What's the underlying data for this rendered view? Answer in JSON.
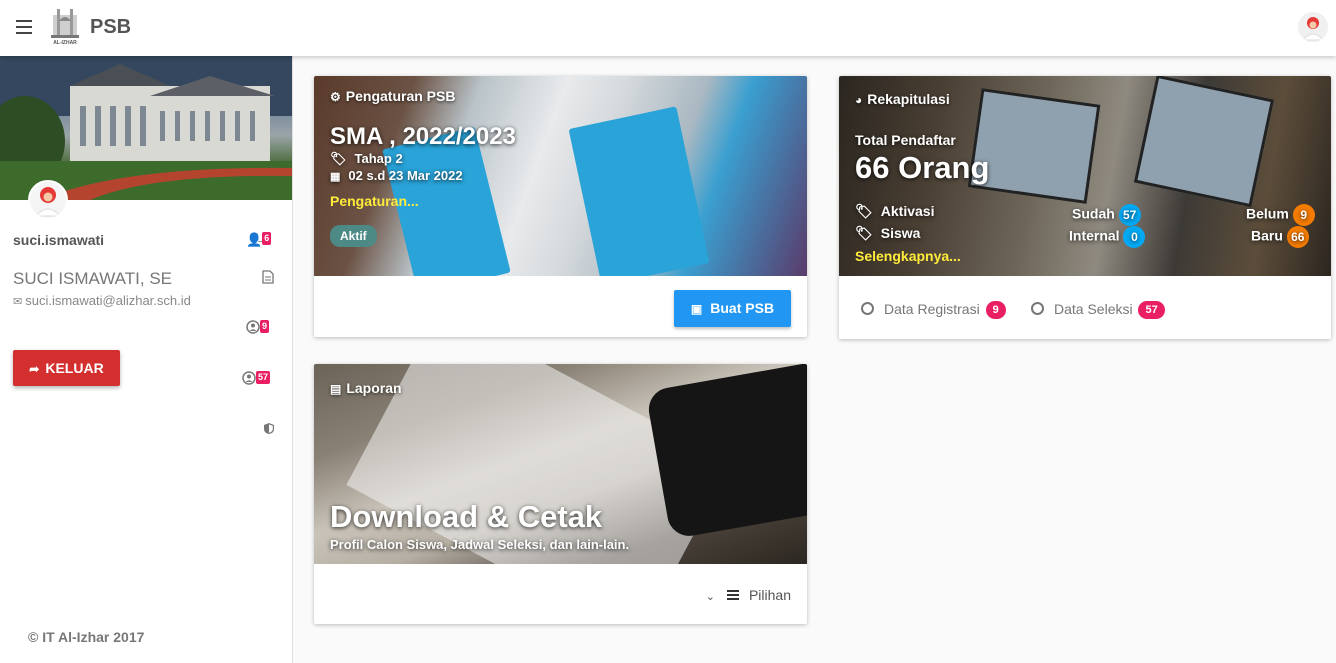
{
  "header": {
    "title": "PSB",
    "logo_text": "AL-IZHAR"
  },
  "sidebar": {
    "username": "suci.ismawati",
    "fullname": "SUCI ISMAWATI, SE",
    "email": "suci.ismawati@alizhar.sch.id",
    "logout_label": "KELUAR",
    "icons": [
      {
        "icon": "user-times-icon",
        "badge": "6"
      },
      {
        "icon": "document-icon",
        "badge": ""
      },
      {
        "icon": "user-circle-icon",
        "badge": "9"
      },
      {
        "icon": "user-circle-icon",
        "badge": "57"
      },
      {
        "icon": "shield-icon",
        "badge": ""
      }
    ],
    "copyright": "© IT Al-Izhar 2017"
  },
  "psb_card": {
    "header": "Pengaturan PSB",
    "title": "SMA , 2022/2023",
    "stage": "Tahap 2",
    "period": "02 s.d 23 Mar 2022",
    "settings_link": "Pengaturan...",
    "status": "Aktif",
    "button": "Buat PSB"
  },
  "rekap_card": {
    "header": "Rekapitulasi",
    "total_label": "Total Pendaftar",
    "total_value": "66 Orang",
    "row1_label": "Aktivasi",
    "row2_label": "Siswa",
    "sudah_label": "Sudah",
    "sudah_value": "57",
    "belum_label": "Belum",
    "belum_value": "9",
    "internal_label": "Internal",
    "internal_value": "0",
    "baru_label": "Baru",
    "baru_value": "66",
    "more_link": "Selengkapnya...",
    "link1_label": "Data Registrasi",
    "link1_badge": "9",
    "link2_label": "Data Seleksi",
    "link2_badge": "57"
  },
  "laporan_card": {
    "header": "Laporan",
    "title": "Download & Cetak",
    "subtitle": "Profil Calon Siswa, Jadwal Seleksi, dan lain-lain.",
    "menu_label": "Pilihan"
  },
  "colors": {
    "primary": "#2196f3",
    "danger": "#d32f2f",
    "pink_badge": "#e91e63",
    "blue_badge": "#03a9f4",
    "orange_badge": "#f57c00",
    "link_yellow": "#ffeb3b"
  }
}
